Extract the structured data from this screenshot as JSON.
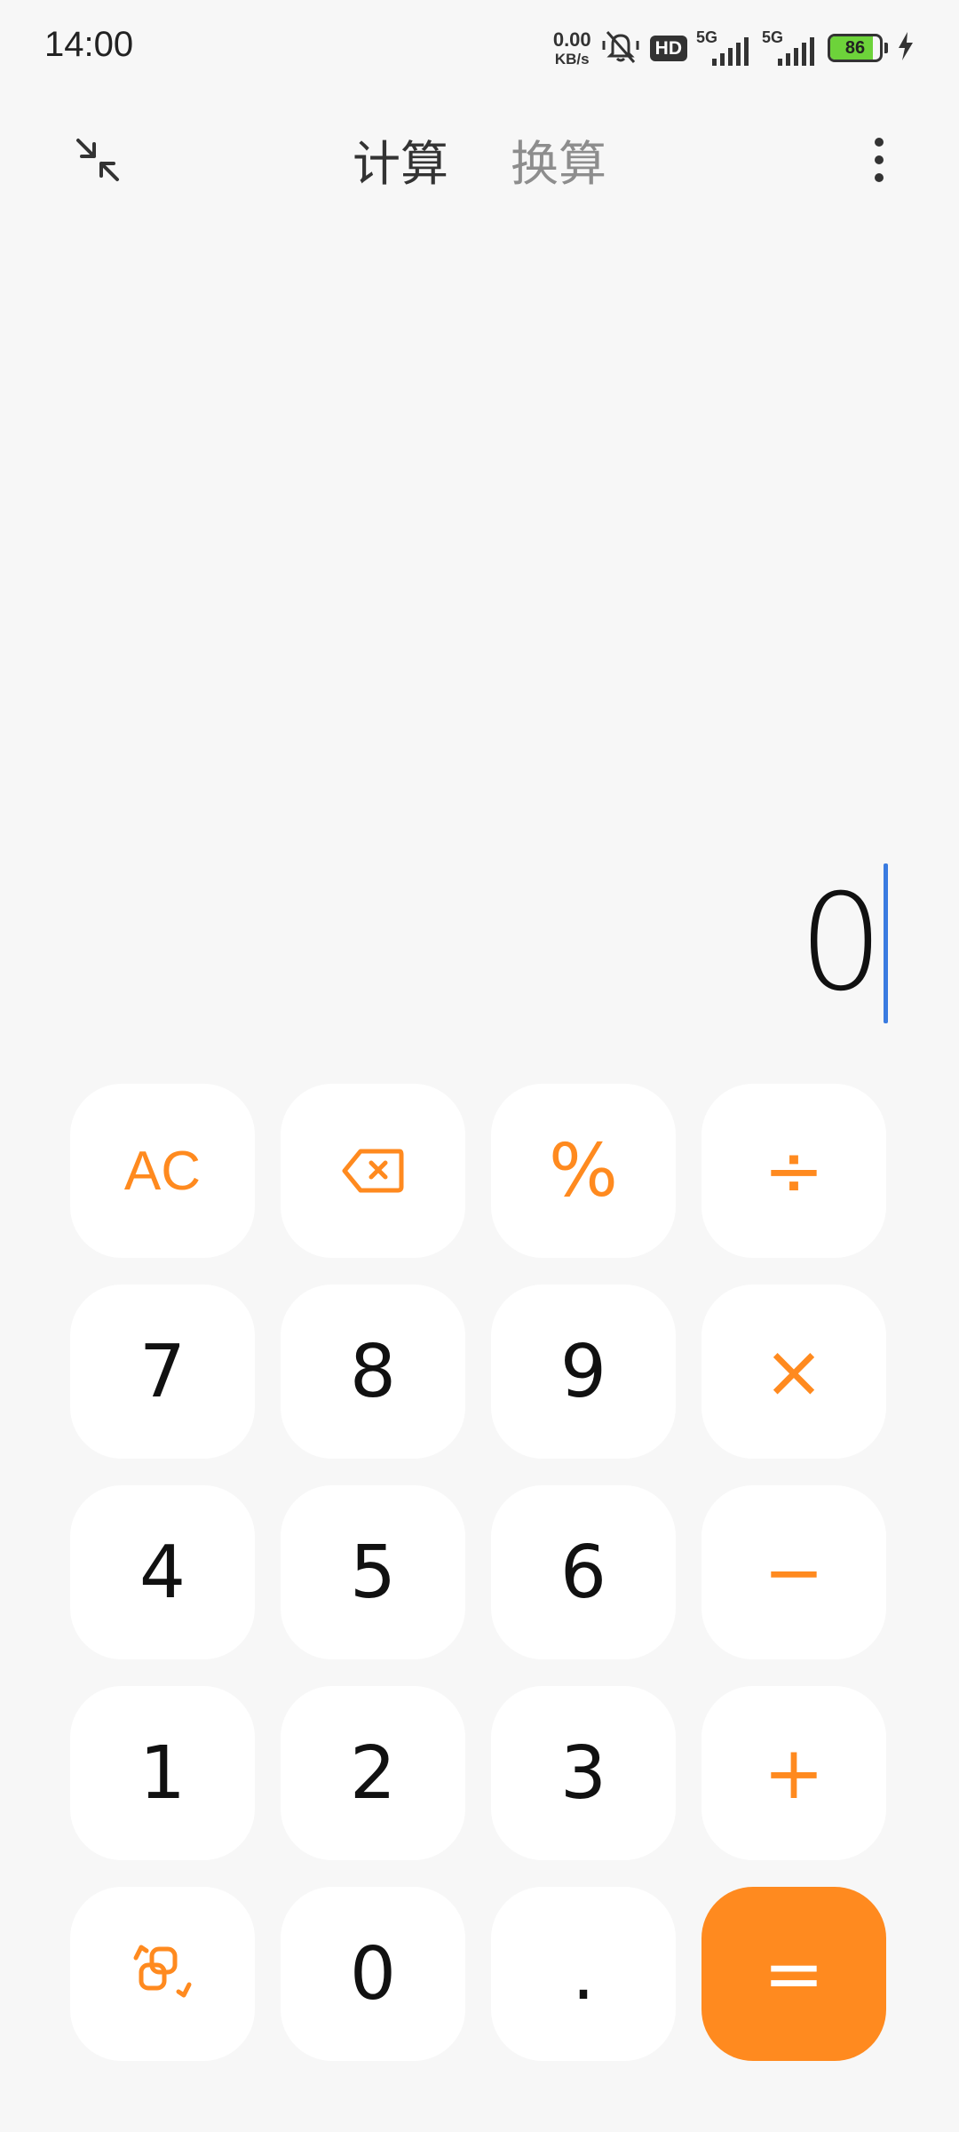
{
  "status_bar": {
    "time": "14:00",
    "net_speed_value": "0.00",
    "net_speed_unit": "KB/s",
    "hd_label": "HD",
    "sim1_label": "5G",
    "sim2_label": "5G",
    "battery_level": "86",
    "battery_fraction": 0.86,
    "battery_color": "#6dd33a"
  },
  "header": {
    "tabs": [
      {
        "label": "计算",
        "active": true
      },
      {
        "label": "换算",
        "active": false
      }
    ],
    "left_icon": "collapse-icon",
    "right_icon": "more-vertical-icon"
  },
  "display": {
    "value": "0"
  },
  "keypad": {
    "accent_color": "#ff8a1f",
    "keys": {
      "ac": "AC",
      "backspace": "backspace-icon",
      "percent": "%",
      "divide": "÷",
      "seven": "7",
      "eight": "8",
      "nine": "9",
      "multiply": "×",
      "four": "4",
      "five": "5",
      "six": "6",
      "minus": "−",
      "one": "1",
      "two": "2",
      "three": "3",
      "plus": "+",
      "switch": "switch-mode-icon",
      "zero": "0",
      "dot": ".",
      "equals": "="
    }
  }
}
